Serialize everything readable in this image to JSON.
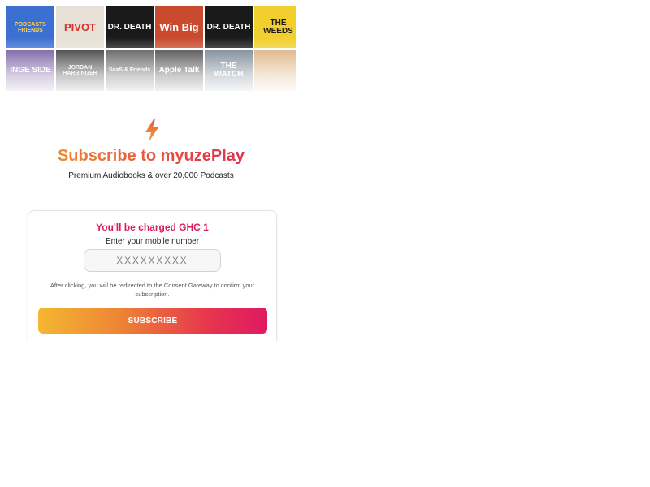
{
  "covers": [
    {
      "label": "PODCASTS FRIENDS",
      "bg": "#3b6fd1",
      "fg": "#ffd24a"
    },
    {
      "label": "PIVOT",
      "bg": "#e7e0d6",
      "fg": "#d6312a"
    },
    {
      "label": "DR. DEATH",
      "bg": "#1a1a1a",
      "fg": "#ffffff"
    },
    {
      "label": "Win Big",
      "bg": "#c94a2d",
      "fg": "#ffffff"
    },
    {
      "label": "DR. DEATH",
      "bg": "#1a1a1a",
      "fg": "#ffffff"
    },
    {
      "label": "THE WEEDS",
      "bg": "#f2cf2c",
      "fg": "#1a1a1a"
    },
    {
      "label": "INGE SIDE",
      "bg": "#5b3b8f",
      "fg": "#ffffff"
    },
    {
      "label": "JORDAN HARBINGER",
      "bg": "#1c1c1c",
      "fg": "#e8e8e8"
    },
    {
      "label": "SaaS & Friends",
      "bg": "#3d3d3d",
      "fg": "#ffffff"
    },
    {
      "label": "Apple Talk",
      "bg": "#2c2c2c",
      "fg": "#ffffff"
    },
    {
      "label": "THE WATCH",
      "bg": "#5d6f80",
      "fg": "#ffffff"
    },
    {
      "label": "",
      "bg": "#d8a46a",
      "fg": "#ffffff"
    }
  ],
  "header": {
    "title": "Subscribe to myuzePlay",
    "subtitle": "Premium Audiobooks & over 20,000 Podcasts",
    "logo_icon": "lightning-bolt-icon"
  },
  "card": {
    "charge_text": "You'll be charged GH₵ 1",
    "enter_label": "Enter your mobile number",
    "phone_placeholder": "XXXXXXXXX",
    "note": "After clicking, you will be redirected to the Consent Gateway to confirm your subscription.",
    "button_label": "SUBSCRIBE"
  },
  "colors": {
    "accent_pink": "#d91d5f",
    "accent_orange": "#f2a42b",
    "gradient_start": "#f4b731",
    "gradient_end": "#de1a63"
  }
}
